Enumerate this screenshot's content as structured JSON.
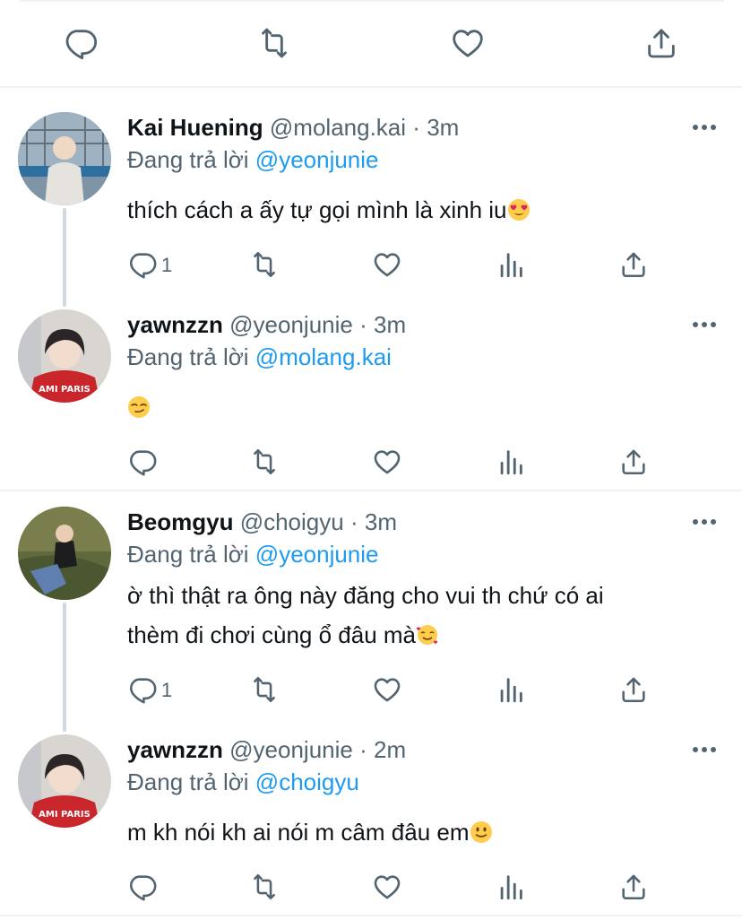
{
  "tweets": [
    {
      "name": "Kai Huening",
      "handle": "@molang.kai",
      "dot": "·",
      "time": "3m",
      "replying_prefix": "Đang trả lời",
      "replying_to": "@yeonjunie",
      "text": "thích cách a ấy tự gọi mình là xinh iu",
      "emoji": "heart-eyes",
      "reply_count": "1"
    },
    {
      "name": "yawnzzn",
      "handle": "@yeonjunie",
      "dot": "·",
      "time": "3m",
      "replying_prefix": "Đang trả lời",
      "replying_to": "@molang.kai",
      "text": "",
      "emoji": "smirk",
      "reply_count": ""
    },
    {
      "name": "Beomgyu",
      "handle": "@choigyu",
      "dot": "·",
      "time": "3m",
      "replying_prefix": "Đang trả lời",
      "replying_to": "@yeonjunie",
      "text_line1": "ờ thì thật ra ông này đăng cho vui th chứ có ai",
      "text_line2": "thèm đi chơi cùng ổ đâu mà",
      "emoji": "smiling-hearts",
      "reply_count": "1"
    },
    {
      "name": "yawnzzn",
      "handle": "@yeonjunie",
      "dot": "·",
      "time": "2m",
      "replying_prefix": "Đang trả lời",
      "replying_to": "@choigyu",
      "text": "m kh nói kh ai nói m câm đâu em",
      "emoji": "slight-smile",
      "reply_count": ""
    }
  ],
  "colors": {
    "text": "#0f1419",
    "secondary": "#536471",
    "link": "#1d9bf0",
    "divider": "#eff1f3",
    "thread_line": "#cfd9de"
  },
  "icons": [
    "reply-icon",
    "retweet-icon",
    "like-icon",
    "analytics-icon",
    "share-icon",
    "more-icon"
  ]
}
